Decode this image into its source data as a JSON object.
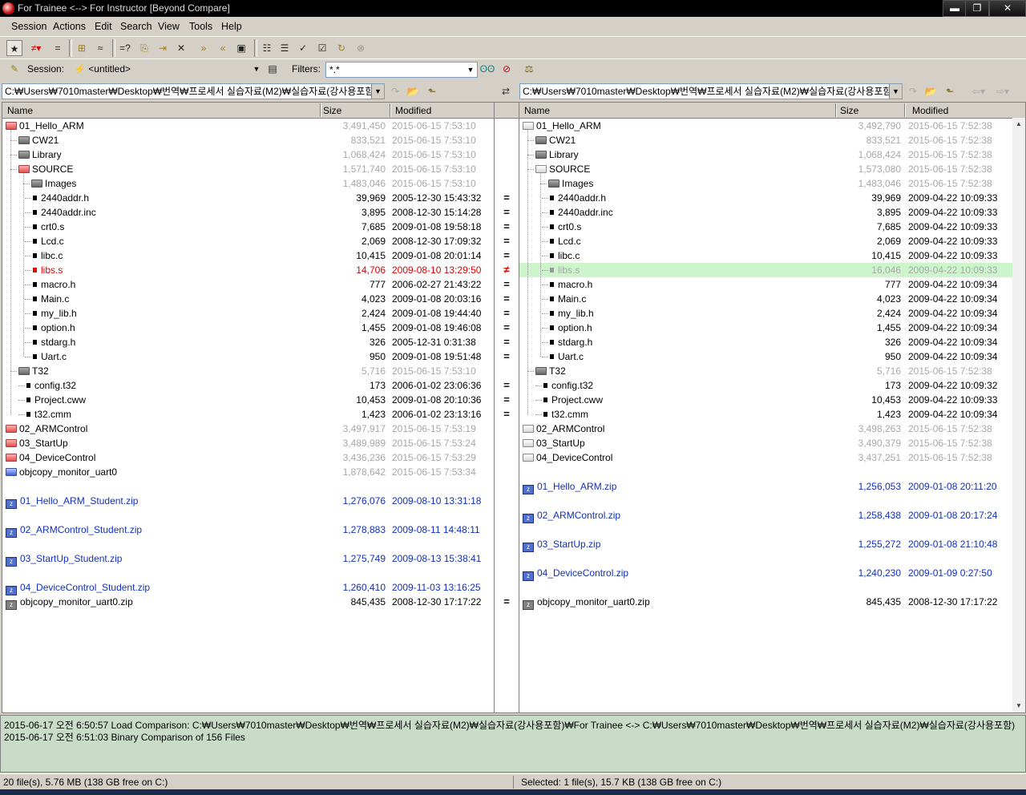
{
  "window": {
    "title": "For Trainee <--> For Instructor  [Beyond Compare]",
    "min": "▬",
    "max": "❐",
    "close": "✕"
  },
  "menu": [
    "Session",
    "Actions",
    "Edit",
    "Search",
    "View",
    "Tools",
    "Help"
  ],
  "toolbar_icons": [
    "show-all-icon",
    "show-differences-icon",
    "show-same-icon",
    "expand-icon",
    "binary-icon",
    "compare-contents-icon",
    "copy-to-folder-icon",
    "move-to-folder-icon",
    "delete-icon",
    "sync-right-icon",
    "sync-left-icon",
    "snapshot-icon",
    "tree-view-icon",
    "flatten-icon",
    "check-icon",
    "attributes-icon",
    "refresh-icon",
    "stop-icon"
  ],
  "session": {
    "label": "Session:",
    "value": "<untitled>",
    "filters_label": "Filters:",
    "filters_value": "*.*"
  },
  "left_path": "C:₩Users₩7010master₩Desktop₩번역₩프로세서 실습자료(M2)₩실습자료(강사용포함)",
  "right_path": "C:₩Users₩7010master₩Desktop₩번역₩프로세서 실습자료(M2)₩실습자료(강사용포함)",
  "columns": {
    "name": "Name",
    "size": "Size",
    "modified": "Modified"
  },
  "left_rows": [
    {
      "name": "01_Hello_ARM",
      "size": "3,491,450",
      "mod": "2015-06-15 7:53:10",
      "icon": "folder",
      "ic": "red",
      "tc": "black",
      "sc": "gray",
      "lvl": 0
    },
    {
      "name": "CW21",
      "size": "833,521",
      "mod": "2015-06-15 7:53:10",
      "icon": "folder",
      "ic": "gray",
      "tc": "black",
      "sc": "gray",
      "lvl": 1
    },
    {
      "name": "Library",
      "size": "1,068,424",
      "mod": "2015-06-15 7:53:10",
      "icon": "folder",
      "ic": "gray",
      "tc": "black",
      "sc": "gray",
      "lvl": 1
    },
    {
      "name": "SOURCE",
      "size": "1,571,740",
      "mod": "2015-06-15 7:53:10",
      "icon": "folder",
      "ic": "red",
      "tc": "black",
      "sc": "gray",
      "lvl": 1
    },
    {
      "name": "Images",
      "size": "1,483,046",
      "mod": "2015-06-15 7:53:10",
      "icon": "folder",
      "ic": "gray",
      "tc": "black",
      "sc": "gray",
      "lvl": 2
    },
    {
      "name": "2440addr.h",
      "size": "39,969",
      "mod": "2005-12-30 15:43:32",
      "icon": "file",
      "ic": "",
      "tc": "black",
      "sc": "black",
      "lvl": 2
    },
    {
      "name": "2440addr.inc",
      "size": "3,895",
      "mod": "2008-12-30 15:14:28",
      "icon": "file",
      "ic": "",
      "tc": "black",
      "sc": "black",
      "lvl": 2
    },
    {
      "name": "crt0.s",
      "size": "7,685",
      "mod": "2009-01-08 19:58:18",
      "icon": "file",
      "ic": "",
      "tc": "black",
      "sc": "black",
      "lvl": 2
    },
    {
      "name": "Lcd.c",
      "size": "2,069",
      "mod": "2008-12-30 17:09:32",
      "icon": "file",
      "ic": "",
      "tc": "black",
      "sc": "black",
      "lvl": 2
    },
    {
      "name": "libc.c",
      "size": "10,415",
      "mod": "2009-01-08 20:01:14",
      "icon": "file",
      "ic": "",
      "tc": "black",
      "sc": "black",
      "lvl": 2
    },
    {
      "name": "libs.s",
      "size": "14,706",
      "mod": "2009-08-10 13:29:50",
      "icon": "file",
      "ic": "red",
      "tc": "red",
      "sc": "red",
      "lvl": 2
    },
    {
      "name": "macro.h",
      "size": "777",
      "mod": "2006-02-27 21:43:22",
      "icon": "file",
      "ic": "",
      "tc": "black",
      "sc": "black",
      "lvl": 2
    },
    {
      "name": "Main.c",
      "size": "4,023",
      "mod": "2009-01-08 20:03:16",
      "icon": "file",
      "ic": "",
      "tc": "black",
      "sc": "black",
      "lvl": 2
    },
    {
      "name": "my_lib.h",
      "size": "2,424",
      "mod": "2009-01-08 19:44:40",
      "icon": "file",
      "ic": "",
      "tc": "black",
      "sc": "black",
      "lvl": 2
    },
    {
      "name": "option.h",
      "size": "1,455",
      "mod": "2009-01-08 19:46:08",
      "icon": "file",
      "ic": "",
      "tc": "black",
      "sc": "black",
      "lvl": 2
    },
    {
      "name": "stdarg.h",
      "size": "326",
      "mod": "2005-12-31 0:31:38",
      "icon": "file",
      "ic": "",
      "tc": "black",
      "sc": "black",
      "lvl": 2
    },
    {
      "name": "Uart.c",
      "size": "950",
      "mod": "2009-01-08 19:51:48",
      "icon": "file",
      "ic": "",
      "tc": "black",
      "sc": "black",
      "lvl": 2
    },
    {
      "name": "T32",
      "size": "5,716",
      "mod": "2015-06-15 7:53:10",
      "icon": "folder",
      "ic": "gray",
      "tc": "black",
      "sc": "gray",
      "lvl": 1
    },
    {
      "name": "config.t32",
      "size": "173",
      "mod": "2006-01-02 23:06:36",
      "icon": "file",
      "ic": "",
      "tc": "black",
      "sc": "black",
      "lvl": 1
    },
    {
      "name": "Project.cww",
      "size": "10,453",
      "mod": "2009-01-08 20:10:36",
      "icon": "file",
      "ic": "",
      "tc": "black",
      "sc": "black",
      "lvl": 1
    },
    {
      "name": "t32.cmm",
      "size": "1,423",
      "mod": "2006-01-02 23:13:16",
      "icon": "file",
      "ic": "",
      "tc": "black",
      "sc": "black",
      "lvl": 1
    },
    {
      "name": "02_ARMControl",
      "size": "3,497,917",
      "mod": "2015-06-15 7:53:19",
      "icon": "folder",
      "ic": "red",
      "tc": "black",
      "sc": "gray",
      "lvl": 0
    },
    {
      "name": "03_StartUp",
      "size": "3,489,989",
      "mod": "2015-06-15 7:53:24",
      "icon": "folder",
      "ic": "red",
      "tc": "black",
      "sc": "gray",
      "lvl": 0
    },
    {
      "name": "04_DeviceControl",
      "size": "3,436,236",
      "mod": "2015-06-15 7:53:29",
      "icon": "folder",
      "ic": "red",
      "tc": "black",
      "sc": "gray",
      "lvl": 0
    },
    {
      "name": "objcopy_monitor_uart0",
      "size": "1,878,642",
      "mod": "2015-06-15 7:53:34",
      "icon": "folder",
      "ic": "blue",
      "tc": "black",
      "sc": "gray",
      "lvl": 0
    },
    {
      "name": "",
      "size": "",
      "mod": "",
      "icon": "none",
      "ic": "",
      "tc": "black",
      "sc": "black",
      "lvl": 0
    },
    {
      "name": "01_Hello_ARM_Student.zip",
      "size": "1,276,076",
      "mod": "2009-08-10 13:31:18",
      "icon": "zip",
      "ic": "blue",
      "tc": "blue",
      "sc": "blue",
      "lvl": 0
    },
    {
      "name": "",
      "size": "",
      "mod": "",
      "icon": "none",
      "ic": "",
      "tc": "black",
      "sc": "black",
      "lvl": 0
    },
    {
      "name": "02_ARMControl_Student.zip",
      "size": "1,278,883",
      "mod": "2009-08-11 14:48:11",
      "icon": "zip",
      "ic": "blue",
      "tc": "blue",
      "sc": "blue",
      "lvl": 0
    },
    {
      "name": "",
      "size": "",
      "mod": "",
      "icon": "none",
      "ic": "",
      "tc": "black",
      "sc": "black",
      "lvl": 0
    },
    {
      "name": "03_StartUp_Student.zip",
      "size": "1,275,749",
      "mod": "2009-08-13 15:38:41",
      "icon": "zip",
      "ic": "blue",
      "tc": "blue",
      "sc": "blue",
      "lvl": 0
    },
    {
      "name": "",
      "size": "",
      "mod": "",
      "icon": "none",
      "ic": "",
      "tc": "black",
      "sc": "black",
      "lvl": 0
    },
    {
      "name": "04_DeviceControl_Student.zip",
      "size": "1,260,410",
      "mod": "2009-11-03 13:16:25",
      "icon": "zip",
      "ic": "blue",
      "tc": "blue",
      "sc": "blue",
      "lvl": 0
    },
    {
      "name": "objcopy_monitor_uart0.zip",
      "size": "845,435",
      "mod": "2008-12-30 17:17:22",
      "icon": "zip",
      "ic": "gray",
      "tc": "black",
      "sc": "black",
      "lvl": 0
    }
  ],
  "right_rows": [
    {
      "name": "01_Hello_ARM",
      "size": "3,492,790",
      "mod": "2015-06-15 7:52:38",
      "icon": "folder",
      "ic": "white",
      "tc": "black",
      "sc": "gray",
      "lvl": 0
    },
    {
      "name": "CW21",
      "size": "833,521",
      "mod": "2015-06-15 7:52:38",
      "icon": "folder",
      "ic": "gray",
      "tc": "black",
      "sc": "gray",
      "lvl": 1
    },
    {
      "name": "Library",
      "size": "1,068,424",
      "mod": "2015-06-15 7:52:38",
      "icon": "folder",
      "ic": "gray",
      "tc": "black",
      "sc": "gray",
      "lvl": 1
    },
    {
      "name": "SOURCE",
      "size": "1,573,080",
      "mod": "2015-06-15 7:52:38",
      "icon": "folder",
      "ic": "white",
      "tc": "black",
      "sc": "gray",
      "lvl": 1
    },
    {
      "name": "Images",
      "size": "1,483,046",
      "mod": "2015-06-15 7:52:38",
      "icon": "folder",
      "ic": "gray",
      "tc": "black",
      "sc": "gray",
      "lvl": 2
    },
    {
      "name": "2440addr.h",
      "size": "39,969",
      "mod": "2009-04-22 10:09:33",
      "icon": "file",
      "ic": "",
      "tc": "black",
      "sc": "black",
      "lvl": 2
    },
    {
      "name": "2440addr.inc",
      "size": "3,895",
      "mod": "2009-04-22 10:09:33",
      "icon": "file",
      "ic": "",
      "tc": "black",
      "sc": "black",
      "lvl": 2
    },
    {
      "name": "crt0.s",
      "size": "7,685",
      "mod": "2009-04-22 10:09:33",
      "icon": "file",
      "ic": "",
      "tc": "black",
      "sc": "black",
      "lvl": 2
    },
    {
      "name": "Lcd.c",
      "size": "2,069",
      "mod": "2009-04-22 10:09:33",
      "icon": "file",
      "ic": "",
      "tc": "black",
      "sc": "black",
      "lvl": 2
    },
    {
      "name": "libc.c",
      "size": "10,415",
      "mod": "2009-04-22 10:09:33",
      "icon": "file",
      "ic": "",
      "tc": "black",
      "sc": "black",
      "lvl": 2
    },
    {
      "name": "libs.s",
      "size": "16,046",
      "mod": "2009-04-22 10:09:33",
      "icon": "file",
      "ic": "gray",
      "tc": "gray",
      "sc": "gray",
      "lvl": 2,
      "hl": true
    },
    {
      "name": "macro.h",
      "size": "777",
      "mod": "2009-04-22 10:09:34",
      "icon": "file",
      "ic": "",
      "tc": "black",
      "sc": "black",
      "lvl": 2
    },
    {
      "name": "Main.c",
      "size": "4,023",
      "mod": "2009-04-22 10:09:34",
      "icon": "file",
      "ic": "",
      "tc": "black",
      "sc": "black",
      "lvl": 2
    },
    {
      "name": "my_lib.h",
      "size": "2,424",
      "mod": "2009-04-22 10:09:34",
      "icon": "file",
      "ic": "",
      "tc": "black",
      "sc": "black",
      "lvl": 2
    },
    {
      "name": "option.h",
      "size": "1,455",
      "mod": "2009-04-22 10:09:34",
      "icon": "file",
      "ic": "",
      "tc": "black",
      "sc": "black",
      "lvl": 2
    },
    {
      "name": "stdarg.h",
      "size": "326",
      "mod": "2009-04-22 10:09:34",
      "icon": "file",
      "ic": "",
      "tc": "black",
      "sc": "black",
      "lvl": 2
    },
    {
      "name": "Uart.c",
      "size": "950",
      "mod": "2009-04-22 10:09:34",
      "icon": "file",
      "ic": "",
      "tc": "black",
      "sc": "black",
      "lvl": 2
    },
    {
      "name": "T32",
      "size": "5,716",
      "mod": "2015-06-15 7:52:38",
      "icon": "folder",
      "ic": "gray",
      "tc": "black",
      "sc": "gray",
      "lvl": 1
    },
    {
      "name": "config.t32",
      "size": "173",
      "mod": "2009-04-22 10:09:32",
      "icon": "file",
      "ic": "",
      "tc": "black",
      "sc": "black",
      "lvl": 1
    },
    {
      "name": "Project.cww",
      "size": "10,453",
      "mod": "2009-04-22 10:09:33",
      "icon": "file",
      "ic": "",
      "tc": "black",
      "sc": "black",
      "lvl": 1
    },
    {
      "name": "t32.cmm",
      "size": "1,423",
      "mod": "2009-04-22 10:09:34",
      "icon": "file",
      "ic": "",
      "tc": "black",
      "sc": "black",
      "lvl": 1
    },
    {
      "name": "02_ARMControl",
      "size": "3,498,263",
      "mod": "2015-06-15 7:52:38",
      "icon": "folder",
      "ic": "white",
      "tc": "black",
      "sc": "gray",
      "lvl": 0
    },
    {
      "name": "03_StartUp",
      "size": "3,490,379",
      "mod": "2015-06-15 7:52:38",
      "icon": "folder",
      "ic": "white",
      "tc": "black",
      "sc": "gray",
      "lvl": 0
    },
    {
      "name": "04_DeviceControl",
      "size": "3,437,251",
      "mod": "2015-06-15 7:52:38",
      "icon": "folder",
      "ic": "white",
      "tc": "black",
      "sc": "gray",
      "lvl": 0
    },
    {
      "name": "",
      "size": "",
      "mod": "",
      "icon": "none",
      "ic": "",
      "tc": "black",
      "sc": "black",
      "lvl": 0
    },
    {
      "name": "01_Hello_ARM.zip",
      "size": "1,256,053",
      "mod": "2009-01-08 20:11:20",
      "icon": "zip",
      "ic": "blue",
      "tc": "blue",
      "sc": "blue",
      "lvl": 0
    },
    {
      "name": "",
      "size": "",
      "mod": "",
      "icon": "none",
      "ic": "",
      "tc": "black",
      "sc": "black",
      "lvl": 0
    },
    {
      "name": "02_ARMControl.zip",
      "size": "1,258,438",
      "mod": "2009-01-08 20:17:24",
      "icon": "zip",
      "ic": "blue",
      "tc": "blue",
      "sc": "blue",
      "lvl": 0
    },
    {
      "name": "",
      "size": "",
      "mod": "",
      "icon": "none",
      "ic": "",
      "tc": "black",
      "sc": "black",
      "lvl": 0
    },
    {
      "name": "03_StartUp.zip",
      "size": "1,255,272",
      "mod": "2009-01-08 21:10:48",
      "icon": "zip",
      "ic": "blue",
      "tc": "blue",
      "sc": "blue",
      "lvl": 0
    },
    {
      "name": "",
      "size": "",
      "mod": "",
      "icon": "none",
      "ic": "",
      "tc": "black",
      "sc": "black",
      "lvl": 0
    },
    {
      "name": "04_DeviceControl.zip",
      "size": "1,240,230",
      "mod": "2009-01-09 0:27:50",
      "icon": "zip",
      "ic": "blue",
      "tc": "blue",
      "sc": "blue",
      "lvl": 0
    },
    {
      "name": "",
      "size": "",
      "mod": "",
      "icon": "none",
      "ic": "",
      "tc": "black",
      "sc": "black",
      "lvl": 0
    },
    {
      "name": "objcopy_monitor_uart0.zip",
      "size": "845,435",
      "mod": "2008-12-30 17:17:22",
      "icon": "zip",
      "ic": "gray",
      "tc": "black",
      "sc": "black",
      "lvl": 0
    }
  ],
  "marks": [
    "",
    "",
    "",
    "",
    "",
    "=",
    "=",
    "=",
    "=",
    "=",
    "≠",
    "=",
    "=",
    "=",
    "=",
    "=",
    "=",
    "",
    "=",
    "=",
    "=",
    "",
    "",
    "",
    "",
    "",
    "",
    "",
    "",
    "",
    "",
    "",
    "",
    "="
  ],
  "log": [
    "2015-06-17 오전 6:50:57  Load Comparison: C:₩Users₩7010master₩Desktop₩번역₩프로세서 실습자료(M2)₩실습자료(강사용포함)₩For Trainee <-> C:₩Users₩7010master₩Desktop₩번역₩프로세서 실습자료(M2)₩실습자료(강사용포함)",
    "2015-06-17 오전 6:51:03  Binary Comparison of 156 Files"
  ],
  "status": {
    "left": "20 file(s), 5.76 MB  (138 GB free on C:)",
    "right": "Selected: 1 file(s), 15.7 KB  (138 GB free on C:)"
  },
  "colors": {
    "red": "#e00000",
    "blue": "#1030c0",
    "gray": "#a8a8a8",
    "log_bg": "#c8dcc8",
    "highlight": "#ccf5cc"
  }
}
